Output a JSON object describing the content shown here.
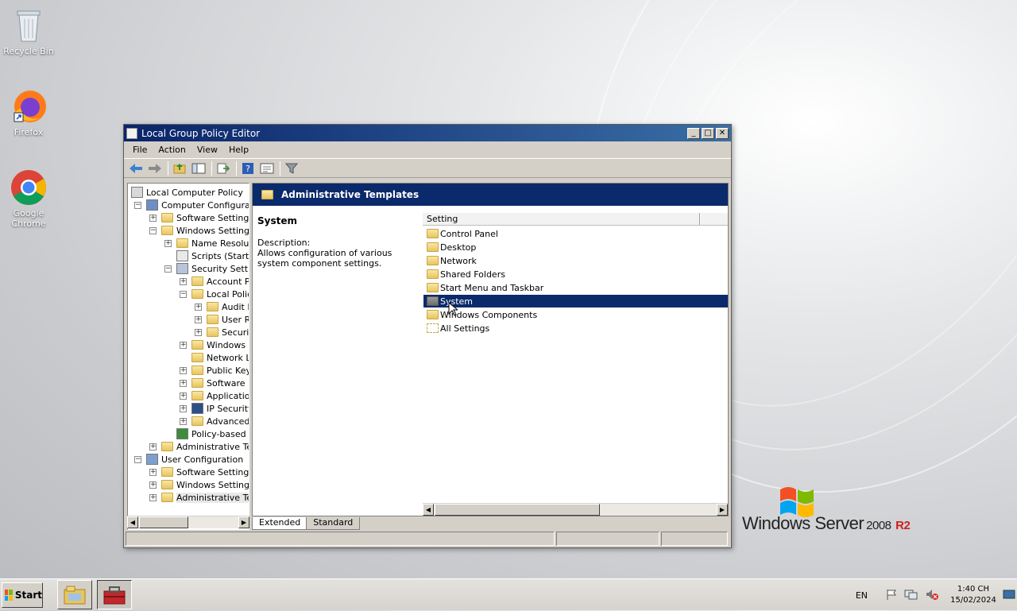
{
  "desktop": {
    "icons": [
      {
        "label": "Recycle Bin",
        "icon": "recycle-bin-icon"
      },
      {
        "label": "Firefox",
        "icon": "firefox-icon"
      },
      {
        "label": "Google Chrome",
        "icon": "chrome-icon"
      }
    ],
    "brand": {
      "name": "Windows Server",
      "version": "2008",
      "edition": "R2"
    }
  },
  "window": {
    "title": "Local Group Policy Editor",
    "menu": [
      "File",
      "Action",
      "View",
      "Help"
    ],
    "toolbar": [
      "back-icon",
      "forward-icon",
      "up-folder-icon",
      "show-hide-tree-icon",
      "export-list-icon",
      "help-icon",
      "properties-icon",
      "filter-icon"
    ],
    "tree": [
      {
        "label": "Local Computer Policy",
        "icon": "policy-icon",
        "level": 0,
        "expander": ""
      },
      {
        "label": "Computer Configuratio",
        "icon": "computer-icon",
        "level": 1,
        "expander": "−"
      },
      {
        "label": "Software Settings",
        "icon": "folder",
        "level": 2,
        "expander": "+"
      },
      {
        "label": "Windows Settings",
        "icon": "folder",
        "level": 2,
        "expander": "−"
      },
      {
        "label": "Name Resolutic",
        "icon": "folder",
        "level": 3,
        "expander": "+"
      },
      {
        "label": "Scripts (Startup",
        "icon": "script-icon",
        "level": 3,
        "expander": ""
      },
      {
        "label": "Security Settin",
        "icon": "security-icon",
        "level": 3,
        "expander": "−"
      },
      {
        "label": "Account Pc",
        "icon": "folder-lock",
        "level": 4,
        "expander": "+"
      },
      {
        "label": "Local Policie",
        "icon": "folder-lock",
        "level": 4,
        "expander": "−"
      },
      {
        "label": "Audit P",
        "icon": "folder-lock",
        "level": 5,
        "expander": "+"
      },
      {
        "label": "User Ri",
        "icon": "folder-lock",
        "level": 5,
        "expander": "+"
      },
      {
        "label": "Securit",
        "icon": "folder-lock",
        "level": 5,
        "expander": "+"
      },
      {
        "label": "Windows F",
        "icon": "folder",
        "level": 4,
        "expander": "+"
      },
      {
        "label": "Network Lis",
        "icon": "folder",
        "level": 4,
        "expander": ""
      },
      {
        "label": "Public Key I",
        "icon": "folder",
        "level": 4,
        "expander": "+"
      },
      {
        "label": "Software R",
        "icon": "folder",
        "level": 4,
        "expander": "+"
      },
      {
        "label": "Application",
        "icon": "folder",
        "level": 4,
        "expander": "+"
      },
      {
        "label": "IP Security",
        "icon": "ipsec-icon",
        "level": 4,
        "expander": "+"
      },
      {
        "label": "Advanced",
        "icon": "folder",
        "level": 4,
        "expander": "+"
      },
      {
        "label": "Policy-based Q",
        "icon": "chart-icon",
        "level": 3,
        "expander": ""
      },
      {
        "label": "Administrative Tem",
        "icon": "folder",
        "level": 2,
        "expander": "+"
      },
      {
        "label": "User Configuration",
        "icon": "user-icon",
        "level": 1,
        "expander": "−"
      },
      {
        "label": "Software Settings",
        "icon": "folder",
        "level": 2,
        "expander": "+"
      },
      {
        "label": "Windows Settings",
        "icon": "folder",
        "level": 2,
        "expander": "+"
      },
      {
        "label": "Administrative Tem",
        "icon": "folder",
        "level": 2,
        "expander": "+",
        "selected": true
      }
    ],
    "content": {
      "header": "Administrative Templates",
      "selected_name": "System",
      "description_label": "Description:",
      "description": "Allows configuration of various system component settings.",
      "column_header": "Setting",
      "items": [
        {
          "label": "Control Panel",
          "icon": "folder"
        },
        {
          "label": "Desktop",
          "icon": "folder"
        },
        {
          "label": "Network",
          "icon": "folder"
        },
        {
          "label": "Shared Folders",
          "icon": "folder"
        },
        {
          "label": "Start Menu and Taskbar",
          "icon": "folder"
        },
        {
          "label": "System",
          "icon": "folder",
          "selected": true
        },
        {
          "label": "Windows Components",
          "icon": "folder"
        },
        {
          "label": "All Settings",
          "icon": "all-settings-icon"
        }
      ]
    },
    "tabs": [
      {
        "label": "Extended",
        "active": true
      },
      {
        "label": "Standard",
        "active": false
      }
    ]
  },
  "taskbar": {
    "start_label": "Start",
    "apps": [
      "explorer-icon",
      "server-manager-icon"
    ],
    "language": "EN",
    "time": "1:40 CH",
    "date": "15/02/2024",
    "tray_icons": [
      "action-center-flag-icon",
      "network-icon",
      "volume-muted-icon"
    ]
  },
  "colors": {
    "header_bg": "#0b2a6b",
    "selection_bg": "#0b2a6b",
    "window_face": "#d4d0c8"
  }
}
